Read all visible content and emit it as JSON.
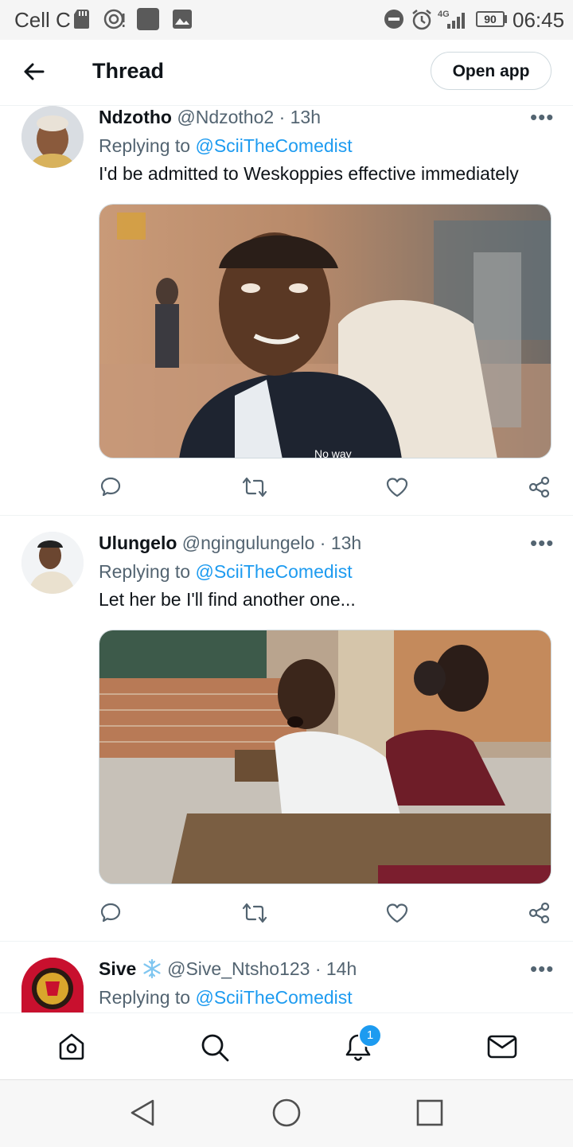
{
  "status_bar": {
    "carrier": "Cell C",
    "network": "4G",
    "battery": "90",
    "time": "06:45"
  },
  "header": {
    "title": "Thread",
    "open_app_label": "Open app"
  },
  "tweets": [
    {
      "name": "Ndzotho",
      "handle": "@Ndzotho2",
      "time": "· 13h",
      "replying_prefix": "Replying to",
      "replying_to": "@SciiTheComedist",
      "text": "I'd be admitted to Weskoppies effective immediately",
      "media_caption": "No way"
    },
    {
      "name": "Ulungelo",
      "handle": "@ngingulungelo",
      "time": "· 13h",
      "replying_prefix": "Replying to",
      "replying_to": "@SciiTheComedist",
      "text": "Let her be I'll find another one..."
    },
    {
      "name": "Sive",
      "handle": "@Sive_Ntsho123",
      "time": "· 14h",
      "replying_prefix": "Replying to",
      "replying_to": "@SciiTheComedist"
    }
  ],
  "bottom_nav": {
    "notifications_count": "1"
  },
  "colors": {
    "accent": "#1d9bf0",
    "text_primary": "#0f1419",
    "text_secondary": "#536471"
  }
}
